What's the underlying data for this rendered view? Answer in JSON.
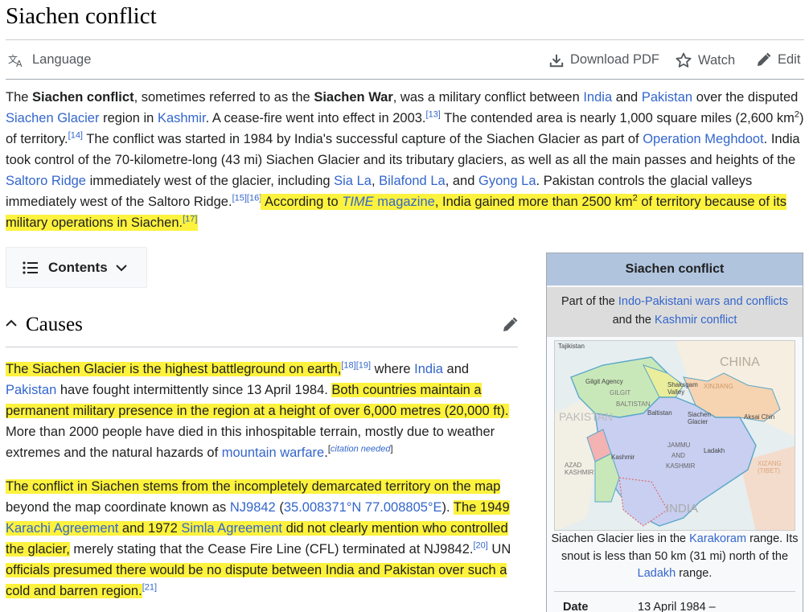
{
  "page": {
    "title": "Siachen conflict"
  },
  "toolbar": {
    "language": "Language",
    "download": "Download PDF",
    "watch": "Watch",
    "edit": "Edit"
  },
  "lead": {
    "s1": "The ",
    "b1": "Siachen conflict",
    "s2": ", sometimes referred to as the ",
    "b2": "Siachen War",
    "s3": ", was a military conflict between ",
    "l_india": "India",
    "s4": " and ",
    "l_pakistan": "Pakistan",
    "s5": " over the disputed ",
    "l_glacier": "Siachen Glacier",
    "s6": " region in ",
    "l_kashmir": "Kashmir",
    "s7": ". A cease-fire went into effect in 2003.",
    "r13": "[13]",
    "s8": " The contended area is nearly 1,000 square miles (2,600 km",
    "sq1": "2",
    "s9": ") of territory.",
    "r14": "[14]",
    "s10": " The conflict was started in 1984 by India's successful capture of the Siachen Glacier as part of ",
    "l_meghdoot": "Operation Meghdoot",
    "s11": ". India took control of the 70-kilometre-long (43 mi) Siachen Glacier and its tributary glaciers, as well as all the main passes and heights of the ",
    "l_saltoro": "Saltoro Ridge",
    "s12": " immediately west of the glacier, including ",
    "l_siala": "Sia La",
    "s13": ", ",
    "l_bilafond": "Bilafond La",
    "s14": ", and ",
    "l_gyong": "Gyong La",
    "s15": ". Pakistan controls the glacial valleys immediately west of the Saltoro Ridge.",
    "r15": "[15]",
    "r16": "[16]",
    "hl1": " According to ",
    "hl_time": "TIME",
    "hl2": " magazine",
    "hl3": ", India gained more than 2500 km",
    "sq2": "2",
    "hl4": " of territory because of its military operations in Siachen.",
    "r17": "[17]"
  },
  "toc": {
    "label": "Contents"
  },
  "causes": {
    "heading": "Causes"
  },
  "para1": {
    "hl1": "The Siachen Glacier is the highest battleground on earth,",
    "r18": "[18]",
    "r19": "[19]",
    "s1": " where ",
    "l_india": "India",
    "s2": " and ",
    "l_pakistan": "Pakistan",
    "s3": " have fought intermittently since 13 April 1984. ",
    "hl2": "Both countries maintain a permanent military presence in the region at a height of over 6,000 metres (20,000 ft).",
    "s4": " More than 2000 people have died in this inhospitable terrain, mostly due to weather extremes and the natural hazards of ",
    "l_warfare": "mountain warfare",
    "s5": ".",
    "cn_open": "[",
    "cn": "citation needed",
    "cn_close": "]"
  },
  "para2": {
    "hl1": "The conflict in Siachen stems from the incompletely demarcated territory on the map",
    "s1": " beyond the map coordinate known as ",
    "l_nj": "NJ9842",
    "s2": " (",
    "l_coord": "35.008371°N 77.008805°E",
    "s3": "). ",
    "hl2a": "The 1949 ",
    "l_karachi": "Karachi Agreement",
    "hl2b": " and 1972 ",
    "l_simla": "Simla Agreement",
    "hl2c": " did not clearly mention who controlled the glacier,",
    "s4": " merely stating that the Cease Fire Line (CFL) terminated at NJ9842.",
    "r20": "[20]",
    "s5": " UN ",
    "hl3": "officials presumed there would be no dispute between India and Pakistan over such a cold and barren region.",
    "r21": "[21]"
  },
  "infobox": {
    "title": "Siachen conflict",
    "part_a": "Part of the ",
    "part_link1": "Indo-Pakistani wars and conflicts",
    "part_b": "and the ",
    "part_link2": "Kashmir conflict",
    "cap_a": "Siachen Glacier lies in the ",
    "cap_link1": "Karakoram",
    "cap_b": " range. Its snout is less than 50 km (31 mi) north of the ",
    "cap_link2": "Ladakh",
    "cap_c": " range.",
    "date_label": "Date",
    "date_value": "13 April 1984 –",
    "map_labels": {
      "china": "CHINA",
      "pakistan": "PAKISTAN",
      "india": "INDIA",
      "gilgit_agency": "Gilgit Agency",
      "gilgit": "GILGIT",
      "baltistan_caps": "BALTISTAN",
      "baltistan": "Baltistan",
      "shaksgam": "Shaksgam Valley",
      "xinjiang": "XINJIANG",
      "aksai_chin": "Aksai Chin",
      "siachen": "Siachen Glacier",
      "jammu": "JAMMU",
      "and": "AND",
      "kashmir": "KASHMIR",
      "ladakh": "Ladakh",
      "xizang": "XIZANG (TIBET)",
      "azad": "AZAD KASHMIR",
      "kashmir_small": "Kashmir",
      "tajikistan": "Tajikistan"
    }
  }
}
